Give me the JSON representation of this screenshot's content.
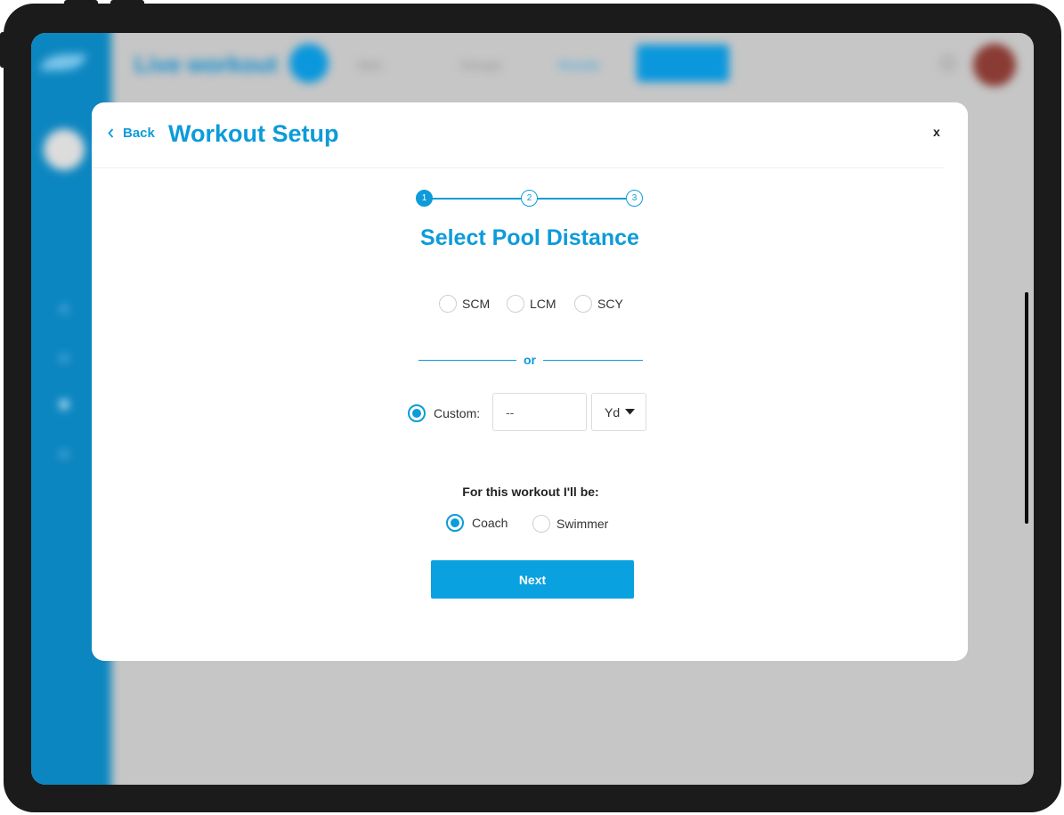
{
  "background_app": {
    "title": "Live workout",
    "menu": [
      "Sets",
      "Groups",
      "Results"
    ]
  },
  "modal": {
    "back_label": "Back",
    "title": "Workout Setup",
    "close_label": "x",
    "steps": [
      "1",
      "2",
      "3"
    ],
    "current_step": 1,
    "section_title": "Select Pool Distance",
    "pool_options": [
      {
        "label": "SCM",
        "selected": false
      },
      {
        "label": "LCM",
        "selected": false
      },
      {
        "label": "SCY",
        "selected": false
      }
    ],
    "separator_text": "or",
    "custom": {
      "label": "Custom:",
      "selected": true,
      "placeholder": "--",
      "unit": "Yd"
    },
    "role": {
      "label": "For this workout I'll be:",
      "options": [
        {
          "label": "Coach",
          "selected": true
        },
        {
          "label": "Swimmer",
          "selected": false
        }
      ]
    },
    "next_label": "Next"
  },
  "colors": {
    "accent": "#0d9bd9",
    "button": "#0aa1e0",
    "overlay": "#c6c6c6"
  }
}
